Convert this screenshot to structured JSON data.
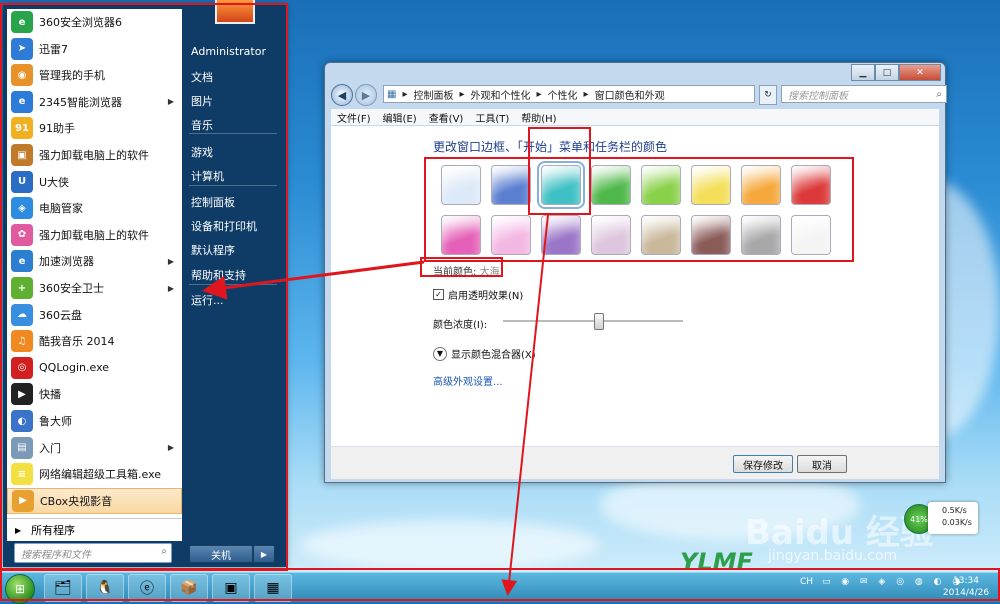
{
  "start_menu": {
    "programs": [
      {
        "label": "360安全浏览器6",
        "color": "#2aa44a",
        "glyph": "e",
        "arrow": false
      },
      {
        "label": "迅雷7",
        "color": "#2f7bd8",
        "glyph": "➤",
        "arrow": false
      },
      {
        "label": "管理我的手机",
        "color": "#e8922a",
        "glyph": "◉",
        "arrow": false
      },
      {
        "label": "2345智能浏览器",
        "color": "#2d7bd8",
        "glyph": "e",
        "arrow": true
      },
      {
        "label": "91助手",
        "color": "#f0b020",
        "glyph": "91",
        "arrow": false
      },
      {
        "label": "强力卸载电脑上的软件",
        "color": "#c07a2a",
        "glyph": "▣",
        "arrow": false
      },
      {
        "label": "U大侠",
        "color": "#2b6cc4",
        "glyph": "U",
        "arrow": false
      },
      {
        "label": "电脑管家",
        "color": "#2d8be0",
        "glyph": "◈",
        "arrow": false
      },
      {
        "label": "强力卸载电脑上的软件",
        "color": "#e05aa0",
        "glyph": "✿",
        "arrow": false
      },
      {
        "label": "加速浏览器",
        "color": "#2c7fd0",
        "glyph": "e",
        "arrow": true
      },
      {
        "label": "360安全卫士",
        "color": "#5fb030",
        "glyph": "+",
        "arrow": true
      },
      {
        "label": "360云盘",
        "color": "#3a8ee0",
        "glyph": "☁",
        "arrow": false
      },
      {
        "label": "酷我音乐 2014",
        "color": "#f08a20",
        "glyph": "♫",
        "arrow": false
      },
      {
        "label": "QQLogin.exe",
        "color": "#d02020",
        "glyph": "◎",
        "arrow": false
      },
      {
        "label": "快播",
        "color": "#222222",
        "glyph": "▶",
        "arrow": false
      },
      {
        "label": "鲁大师",
        "color": "#3a74c8",
        "glyph": "◐",
        "arrow": false
      },
      {
        "label": "入门",
        "color": "#7a9ab8",
        "glyph": "▤",
        "arrow": true
      },
      {
        "label": "网络编辑超级工具箱.exe",
        "color": "#f2e040",
        "glyph": "≡",
        "arrow": false
      },
      {
        "label": "CBox央视影音",
        "color": "#e8a030",
        "glyph": "▶",
        "arrow": false
      }
    ],
    "all_programs": "所有程序",
    "search_placeholder": "搜索程序和文件",
    "right_items": [
      "Administrator",
      "文档",
      "图片",
      "音乐",
      "游戏",
      "计算机",
      "控制面板",
      "设备和打印机",
      "默认程序",
      "帮助和支持",
      "运行..."
    ],
    "shutdown_label": "关机",
    "shutdown_arrow": "▶"
  },
  "window": {
    "controls": {
      "minimize": "▁",
      "maximize": "□",
      "close": "✕"
    },
    "breadcrumb": [
      "控制面板",
      "外观和个性化",
      "个性化",
      "窗口颜色和外观"
    ],
    "search_placeholder": "搜索控制面板",
    "menu": [
      "文件(F)",
      "编辑(E)",
      "查看(V)",
      "工具(T)",
      "帮助(H)"
    ],
    "heading": "更改窗口边框、「开始」菜单和任务栏的颜色",
    "swatches": [
      {
        "color": "#dce9f7",
        "selected": false
      },
      {
        "color": "#5b7fd0",
        "selected": false
      },
      {
        "color": "#3fc0c4",
        "selected": true
      },
      {
        "color": "#4fb84a",
        "selected": false
      },
      {
        "color": "#8ad14a",
        "selected": false
      },
      {
        "color": "#f3df5a",
        "selected": false
      },
      {
        "color": "#f6a83c",
        "selected": false
      },
      {
        "color": "#dc3a3a",
        "selected": false
      },
      {
        "color": "#e560b8",
        "selected": false
      },
      {
        "color": "#f3b7e3",
        "selected": false
      },
      {
        "color": "#9a75c8",
        "selected": false
      },
      {
        "color": "#ddc6de",
        "selected": false
      },
      {
        "color": "#c9b89a",
        "selected": false
      },
      {
        "color": "#8a5c58",
        "selected": false
      },
      {
        "color": "#a8a8a8",
        "selected": false
      },
      {
        "color": "#f4f4f4",
        "selected": false
      }
    ],
    "current_color_label": "当前颜色:",
    "current_color_value": "大海",
    "transparency_label": "启用透明效果(N)",
    "transparency_checked": true,
    "intensity_label": "颜色浓度(I):",
    "intensity_value": 0.53,
    "mixer_label": "显示颜色混合器(X)",
    "advanced_link": "高级外观设置...",
    "save_button": "保存修改",
    "cancel_button": "取消"
  },
  "taskbar": {
    "tray_text": "CH",
    "time": "13:34",
    "date": "2014/4/26"
  },
  "net_monitor": {
    "percent": "41%",
    "up": "0.5K/s",
    "down": "0.03K/s"
  },
  "watermark": {
    "baidu": "Baidu 经验",
    "url": "jingyan.baidu.com",
    "logo": "YLMF"
  },
  "colors": {
    "annotation": "#e0161e",
    "link": "#1a56b8",
    "heading": "#1e3e8a"
  }
}
